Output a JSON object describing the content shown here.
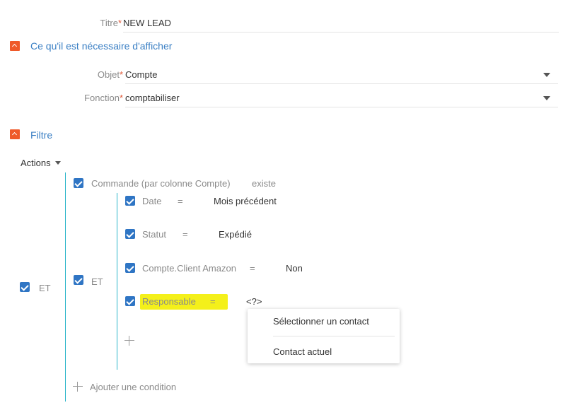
{
  "title_field": {
    "label": "Titre",
    "required_mark": "*",
    "value": "NEW LEAD"
  },
  "section_display": {
    "title": "Ce qu'il est nécessaire d'afficher"
  },
  "object_field": {
    "label": "Objet",
    "required_mark": "*",
    "value": "Compte"
  },
  "function_field": {
    "label": "Fonction",
    "required_mark": "*",
    "value": "comptabiliser"
  },
  "section_filter": {
    "title": "Filtre"
  },
  "actions": {
    "label": "Actions"
  },
  "filter": {
    "root_group_label": "ET",
    "subgroup_label": "ET",
    "aggregate": {
      "column": "Commande (par colonne Compte)",
      "operator": "existe"
    },
    "conditions": [
      {
        "column": "Date",
        "operator": "=",
        "value": "Mois précédent"
      },
      {
        "column": "Statut",
        "operator": "=",
        "value": "Expédié"
      },
      {
        "column": "Compte.Client Amazon",
        "operator": "=",
        "value": "Non"
      },
      {
        "column": "Responsable",
        "operator": "=",
        "value": "<?>"
      }
    ],
    "add_condition_label": "Ajouter une condition"
  },
  "value_menu": {
    "items": [
      {
        "label": "Sélectionner un contact"
      },
      {
        "label": "Contact actuel"
      }
    ]
  },
  "colors": {
    "accent_blue": "#2f75c4",
    "section_title": "#3a7fc4",
    "toggle_orange": "#ef5a2a",
    "group_line": "#2bb5c9",
    "highlight": "#f4f01a"
  }
}
